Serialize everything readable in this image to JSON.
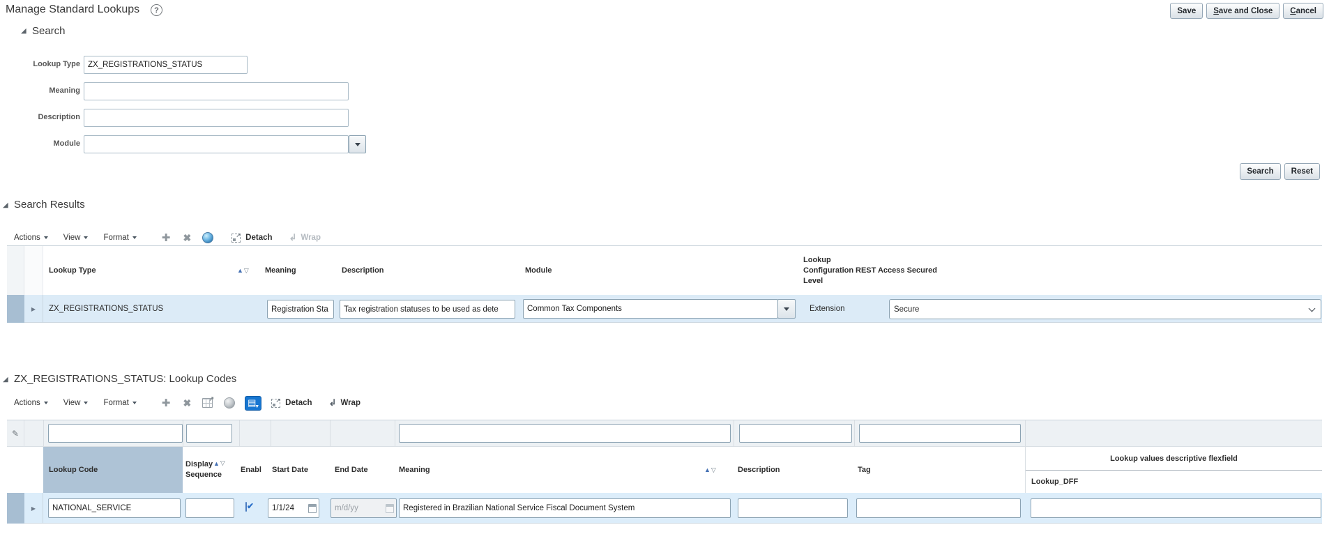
{
  "colors": {
    "accent_blue": "#1776d1",
    "row_selection_bg": "#dcebf7",
    "selection_gutter": "#a7bed2",
    "selected_column_header_bg": "#aec3d6",
    "sort_asc_blue": "#4470b3"
  },
  "page": {
    "title": "Manage Standard Lookups"
  },
  "actions": {
    "save": "Save",
    "save_and_close": "Save and Close",
    "cancel": "Cancel"
  },
  "search": {
    "title": "Search",
    "lookup_type": {
      "label": "Lookup Type",
      "value": "ZX_REGISTRATIONS_STATUS"
    },
    "meaning": {
      "label": "Meaning",
      "value": ""
    },
    "description": {
      "label": "Description",
      "value": ""
    },
    "module": {
      "label": "Module",
      "value": ""
    },
    "search_button": "Search",
    "reset_button": "Reset"
  },
  "results": {
    "title": "Search Results",
    "toolbar": {
      "actions": "Actions",
      "view": "View",
      "format": "Format",
      "detach": "Detach",
      "wrap": "Wrap",
      "icons": [
        "add-icon",
        "delete-icon",
        "translate-icon",
        "detach-icon",
        "wrap-icon"
      ]
    },
    "columns": {
      "lookup_type": "Lookup Type",
      "meaning": "Meaning",
      "description": "Description",
      "module": "Module",
      "config_level": "Lookup Configuration Level",
      "rest_secured": "REST Access Secured"
    },
    "row": {
      "lookup_type": "ZX_REGISTRATIONS_STATUS",
      "meaning": "Registration Sta",
      "description": "Tax registration statuses to be used as dete",
      "module": "Common Tax Components",
      "config_level": "Extension",
      "rest_secured": "Secure"
    }
  },
  "codes": {
    "title": "ZX_REGISTRATIONS_STATUS: Lookup Codes",
    "toolbar": {
      "actions": "Actions",
      "view": "View",
      "format": "Format",
      "detach": "Detach",
      "wrap": "Wrap",
      "icons": [
        "add-icon",
        "delete-icon",
        "export-icon",
        "translate-icon",
        "query-by-example-icon",
        "detach-icon",
        "wrap-icon"
      ]
    },
    "columns": {
      "lookup_code": "Lookup Code",
      "display_sequence": "Display Sequence",
      "enabled": "Enabl",
      "start_date": "Start Date",
      "end_date": "End Date",
      "meaning": "Meaning",
      "description": "Description",
      "tag": "Tag",
      "flexfield_group": "Lookup values descriptive flexfield",
      "flexfield_sub": "Lookup_DFF"
    },
    "filter": {
      "lookup_code": "",
      "display_sequence": "",
      "meaning": "",
      "description": "",
      "tag": ""
    },
    "row": {
      "lookup_code": "NATIONAL_SERVICE",
      "display_sequence": "",
      "enabled": true,
      "start_date": "1/1/24",
      "end_date_placeholder": "m/d/yy",
      "meaning": "Registered in Brazilian National Service Fiscal Document System",
      "description": "",
      "tag": "",
      "lookup_dff": ""
    }
  }
}
